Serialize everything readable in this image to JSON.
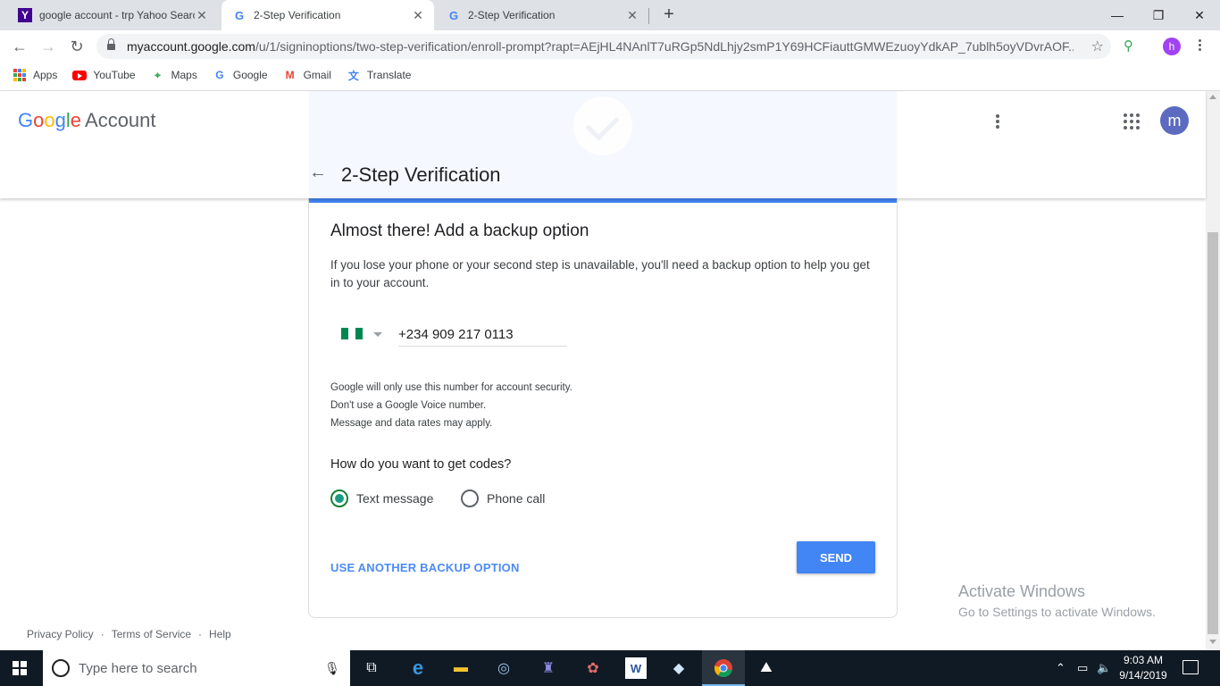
{
  "browser": {
    "tabs": [
      {
        "title": "google account - trp Yahoo Search",
        "favicon": "Y",
        "active": false
      },
      {
        "title": "2-Step Verification",
        "favicon": "G",
        "active": true
      },
      {
        "title": "2-Step Verification",
        "favicon": "G",
        "active": false
      }
    ],
    "new_tab_symbol": "+",
    "window_controls": {
      "minimize": "—",
      "restore": "❐",
      "close": "✕"
    },
    "url_host": "myaccount.google.com",
    "url_path": "/u/1/signinoptions/two-step-verification/enroll-prompt?rapt=AEjHL4NAnlT7uRGp5NdLhjy2smP1Y69HCFiauttGMWEzuoyYdkAP_7ublh5oyVDvrAOF...",
    "profile_initial": "h",
    "bookmarks": [
      "Apps",
      "YouTube",
      "Maps",
      "Google",
      "Gmail",
      "Translate"
    ]
  },
  "header": {
    "logo_word": "Google",
    "logo_suffix": "Account",
    "page_title": "2-Step Verification",
    "avatar_initial": "m"
  },
  "card": {
    "heading": "Almost there! Add a backup option",
    "description": "If you lose your phone or your second step is unavailable, you'll need a backup option to help you get in to your account.",
    "phone_value": "+234 909 217 0113",
    "notes": [
      "Google will only use this number for account security.",
      "Don't use a Google Voice number.",
      "Message and data rates may apply."
    ],
    "question": "How do you want to get codes?",
    "options": [
      {
        "label": "Text message",
        "selected": true
      },
      {
        "label": "Phone call",
        "selected": false
      }
    ],
    "alt_option_label": "USE ANOTHER BACKUP OPTION",
    "send_label": "SEND"
  },
  "footer": {
    "links": [
      "Privacy Policy",
      "Terms of Service",
      "Help"
    ],
    "separator": "·"
  },
  "watermark": {
    "line1": "Activate Windows",
    "line2": "Go to Settings to activate Windows."
  },
  "taskbar": {
    "search_placeholder": "Type here to search",
    "time": "9:03 AM",
    "date": "9/14/2019"
  },
  "colors": {
    "accent_blue": "#4285f4",
    "radio_selected": "#1a9c83",
    "taskbar": "#101a24",
    "profile_purple": "#a142f4",
    "avatar_indigo": "#5c6bc0"
  }
}
